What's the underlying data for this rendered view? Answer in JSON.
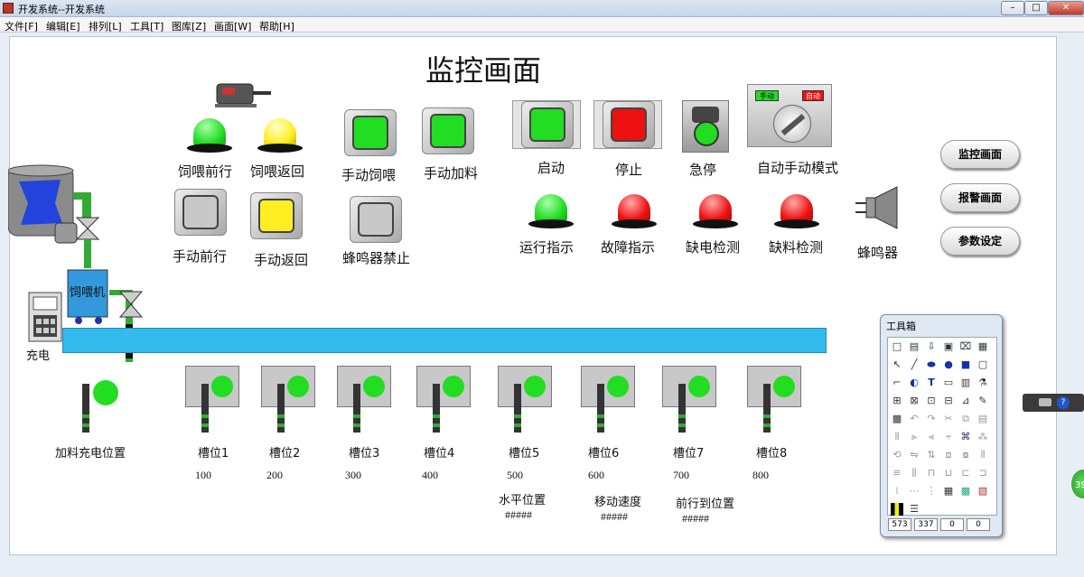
{
  "window": {
    "title": "开发系统--开发系统"
  },
  "menu": [
    "文件[F]",
    "编辑[E]",
    "排列[L]",
    "工具[T]",
    "图库[Z]",
    "画面[W]",
    "帮助[H]"
  ],
  "page_title": "监控画面",
  "buttons": {
    "feed_forward": "饲喂前行",
    "feed_back": "饲喂返回",
    "manual_feed": "手动饲喂",
    "manual_add": "手动加料",
    "manual_forward": "手动前行",
    "manual_back": "手动返回",
    "buzzer_disable": "蜂鸣器禁止",
    "start": "启动",
    "stop": "停止",
    "estop": "急停",
    "auto_manual": "自动手动模式",
    "mode_manual": "手动",
    "mode_auto": "自动"
  },
  "indicators": {
    "run": "运行指示",
    "fault": "故障指示",
    "power_missing": "缺电检测",
    "material_missing": "缺料检测",
    "buzzer": "蜂鸣器"
  },
  "nav": [
    "监控画面",
    "报警画面",
    "参数设定"
  ],
  "equipment": {
    "feeder": "饲喂机",
    "charger": "充电",
    "charge_position": "加料充电位置"
  },
  "slots": [
    {
      "label": "槽位1",
      "value": "100"
    },
    {
      "label": "槽位2",
      "value": "200"
    },
    {
      "label": "槽位3",
      "value": "300"
    },
    {
      "label": "槽位4",
      "value": "400"
    },
    {
      "label": "槽位5",
      "value": "500"
    },
    {
      "label": "槽位6",
      "value": "600"
    },
    {
      "label": "槽位7",
      "value": "700"
    },
    {
      "label": "槽位8",
      "value": "800"
    }
  ],
  "readouts": [
    {
      "label": "水平位置",
      "value": "#####"
    },
    {
      "label": "移动速度",
      "value": "#####"
    },
    {
      "label": "前行到位置",
      "value": "#####"
    }
  ],
  "toolbox": {
    "title": "工具箱",
    "status": [
      "573",
      "337",
      "0",
      "0"
    ]
  },
  "side_badge": "39",
  "colors": {
    "green": "#22dd22",
    "yellow": "#ffee22",
    "red": "#ee1111",
    "conveyor": "#33bbee",
    "feeder": "#3399dd"
  }
}
